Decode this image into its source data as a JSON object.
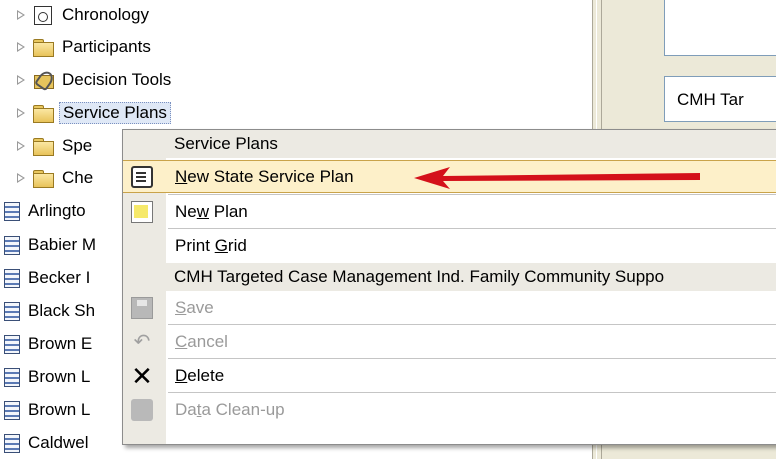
{
  "tree": {
    "branches": [
      {
        "label": "Chronology",
        "icon": "chronology-icon"
      },
      {
        "label": "Participants",
        "icon": "folder-icon"
      },
      {
        "label": "Decision Tools",
        "icon": "decision-tools-icon"
      },
      {
        "label": "Service Plans",
        "icon": "folder-open-icon"
      },
      {
        "label": "Spe",
        "icon": "folder-icon"
      },
      {
        "label": "Che",
        "icon": "folder-icon"
      }
    ],
    "leaves": [
      {
        "label": "Arlingto"
      },
      {
        "label": "Babier M"
      },
      {
        "label": "Becker I"
      },
      {
        "label": "Black Sh"
      },
      {
        "label": "Brown E"
      },
      {
        "label": "Brown L"
      },
      {
        "label": "Brown L"
      },
      {
        "label": "Caldwel"
      }
    ]
  },
  "right_panel": {
    "field_text": "CMH Tar"
  },
  "context_menu": {
    "section1_header": "Service Plans",
    "items_section1": [
      {
        "label": "New State Service Plan",
        "mnemonic": "N",
        "icon": "new-state-plan-icon",
        "highlighted": true
      },
      {
        "label": "New Plan",
        "mnemonic": "w",
        "icon": "new-plan-icon"
      },
      {
        "label": "Print Grid",
        "mnemonic": "G",
        "icon": ""
      }
    ],
    "section2_header": "CMH Targeted Case Management Ind. Family Community Suppo",
    "items_section2": [
      {
        "label": "Save",
        "mnemonic": "S",
        "icon": "save-icon",
        "disabled": true
      },
      {
        "label": "Cancel",
        "mnemonic": "C",
        "icon": "cancel-icon",
        "disabled": true
      },
      {
        "label": "Delete",
        "mnemonic": "D",
        "icon": "delete-icon",
        "disabled": false
      },
      {
        "label": "Data Clean-up",
        "mnemonic": "t",
        "icon": "cleanup-icon",
        "disabled": true
      }
    ]
  },
  "colors": {
    "highlight_bg": "#fdf0c9",
    "arrow": "#d4111a",
    "gutter": "#eceae3"
  }
}
